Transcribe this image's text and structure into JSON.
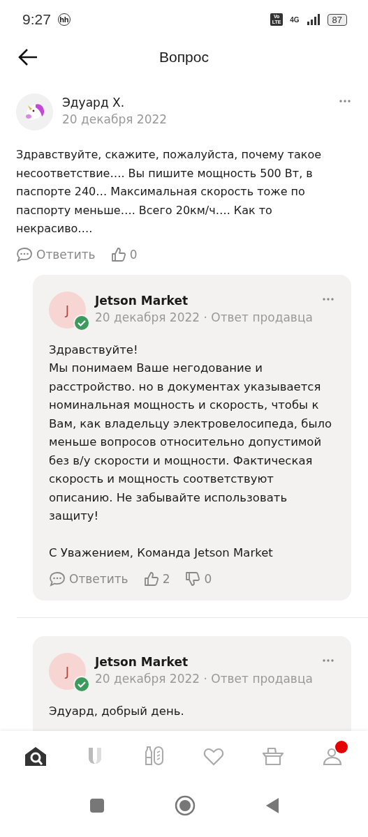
{
  "status_bar": {
    "time": "9:27",
    "notification": "hh",
    "volte": "Vo LTE",
    "network": "4G",
    "battery": "87"
  },
  "header": {
    "title": "Вопрос"
  },
  "question": {
    "author": "Эдуард Х.",
    "date": "20 декабря 2022",
    "text": "Здравствуйте, скажите, пожалуйста, почему такое несоответствие…. Вы пишите мощность 500 Вт, в паспорте 240… Максимальная скорость тоже по паспорту меньше…. Всего 20км/ч…. Как то некрасиво….",
    "reply_label": "Ответить",
    "likes": "0"
  },
  "answers": [
    {
      "author": "Jetson Market",
      "avatar_letter": "J",
      "verified": true,
      "meta": "20 декабря 2022 · Ответ продавца",
      "text": "Здравствуйте!\nМы понимаем Ваше негодование и расстройство. но в документах указывается номинальная мощность и скорость, чтобы к Вам, как владельцу электровелосипеда, было меньше вопросов относительно допустимой без в/у скорости и мощности. Фактическая скорость и мощность соответствуют описанию. Не забывайте использовать защиту!\n\nС Уважением, Команда Jetson Market",
      "reply_label": "Ответить",
      "likes": "2",
      "dislikes": "0"
    },
    {
      "author": "Jetson Market",
      "avatar_letter": "J",
      "verified": true,
      "meta": "20 декабря 2022 · Ответ продавца",
      "text": "Эдуард, добрый день."
    }
  ],
  "bottom_nav": [
    {
      "kind": "home",
      "selected": true,
      "badge": false
    },
    {
      "kind": "brand",
      "selected": false,
      "badge": false
    },
    {
      "kind": "groceries",
      "selected": false,
      "badge": false
    },
    {
      "kind": "favorites",
      "selected": false,
      "badge": false
    },
    {
      "kind": "basket",
      "selected": false,
      "badge": false
    },
    {
      "kind": "profile",
      "selected": false,
      "badge": true
    }
  ]
}
